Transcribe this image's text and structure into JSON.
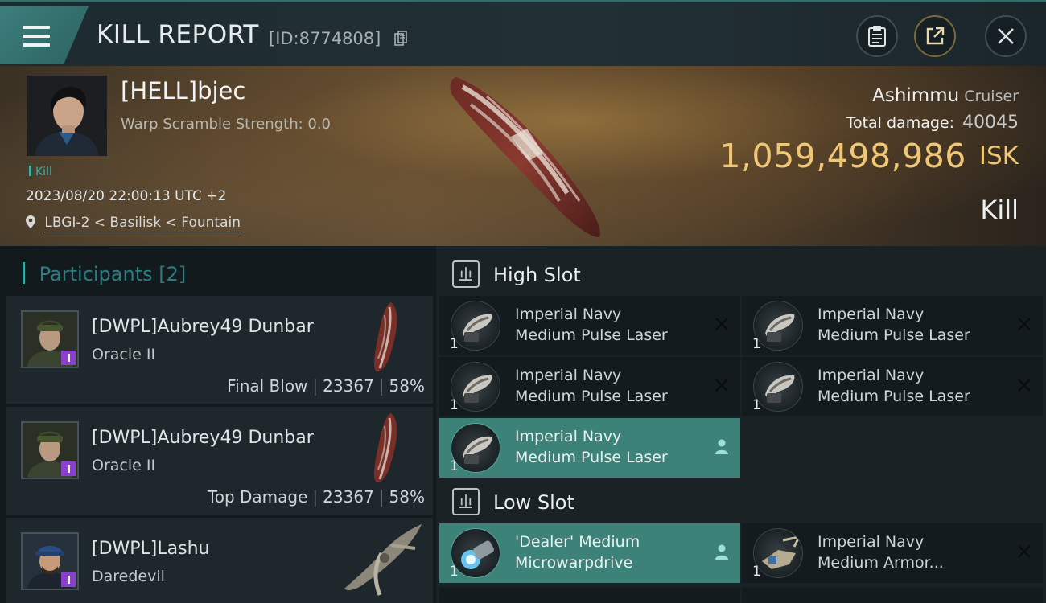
{
  "header": {
    "title": "KILL REPORT",
    "kill_id": "[ID:8774808]"
  },
  "victim": {
    "name": "[HELL]bjec",
    "warp_scramble": "Warp Scramble Strength: 0.0",
    "tag": "Kill",
    "datetime": "2023/08/20 22:00:13 UTC +2",
    "location": "LBGI-2 < Basilisk < Fountain",
    "ship_name": "Ashimmu",
    "ship_class": "Cruiser",
    "total_damage_label": "Total damage:",
    "total_damage": "40045",
    "isk_value": "1,059,498,986",
    "isk_unit": "ISK",
    "result": "Kill"
  },
  "participants": {
    "heading": "Participants",
    "count": "[2]",
    "items": [
      {
        "name": "[DWPL]Aubrey49 Dunbar",
        "ship": "Oracle II",
        "role": "Final Blow",
        "damage": "23367",
        "percent": "58%"
      },
      {
        "name": "[DWPL]Aubrey49 Dunbar",
        "ship": "Oracle II",
        "role": "Top Damage",
        "damage": "23367",
        "percent": "58%"
      },
      {
        "name": "[DWPL]Lashu",
        "ship": "Daredevil"
      }
    ]
  },
  "fitting": {
    "high_slot_label": "High Slot",
    "low_slot_label": "Low Slot",
    "high_slot": [
      {
        "line1": "Imperial Navy",
        "line2": "Medium Pulse Laser",
        "qty": "1",
        "state": "destroyed"
      },
      {
        "line1": "Imperial Navy",
        "line2": "Medium Pulse Laser",
        "qty": "1",
        "state": "destroyed"
      },
      {
        "line1": "Imperial Navy",
        "line2": "Medium Pulse Laser",
        "qty": "1",
        "state": "destroyed"
      },
      {
        "line1": "Imperial Navy",
        "line2": "Medium Pulse Laser",
        "qty": "1",
        "state": "destroyed"
      },
      {
        "line1": "Imperial Navy",
        "line2": "Medium Pulse Laser",
        "qty": "1",
        "state": "dropped"
      }
    ],
    "low_slot": [
      {
        "line1": "'Dealer' Medium",
        "line2": "Microwarpdrive",
        "qty": "1",
        "state": "dropped"
      },
      {
        "line1": "Imperial Navy",
        "line2": "Medium Armor...",
        "qty": "1",
        "state": "destroyed"
      }
    ]
  },
  "colors": {
    "accent": "#3aa6a3",
    "isk_gold": "#f0c776",
    "dropped_row": "#3c8279"
  }
}
